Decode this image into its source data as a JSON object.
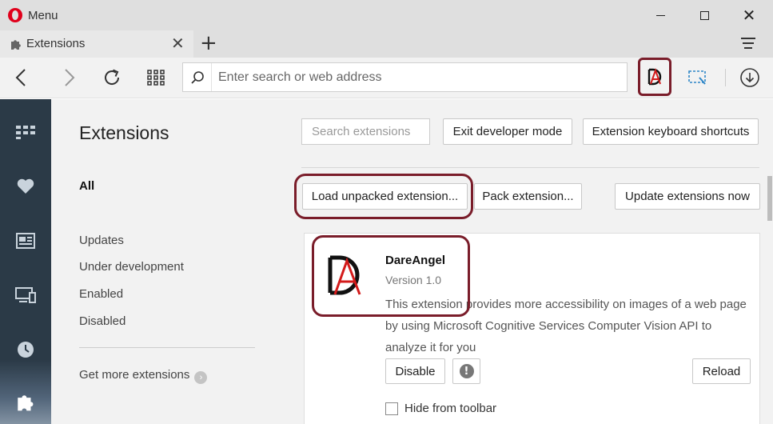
{
  "window": {
    "menu_label": "Menu",
    "minimize_icon": "minimize-icon",
    "maximize_icon": "maximize-icon",
    "close_glyph": "✕"
  },
  "tab": {
    "title": "Extensions",
    "close_glyph": "✕",
    "new_tab_glyph": "+"
  },
  "toolbar": {
    "address_placeholder": "Enter search or web address"
  },
  "extensions_nav": {
    "heading": "Extensions",
    "items": [
      {
        "label": "All"
      },
      {
        "label": "Updates"
      },
      {
        "label": "Under development"
      },
      {
        "label": "Enabled"
      },
      {
        "label": "Disabled"
      }
    ],
    "get_more": "Get more extensions",
    "get_more_arrow": "›"
  },
  "content": {
    "search_placeholder": "Search extensions",
    "buttons": {
      "exit_dev": "Exit developer mode",
      "shortcuts": "Extension keyboard shortcuts",
      "load_unpacked": "Load unpacked extension...",
      "pack": "Pack extension...",
      "update": "Update extensions now"
    },
    "extension": {
      "name": "DareAngel",
      "version": "Version 1.0",
      "description": "This extension provides more accessibility on images of a web page by using Microsoft Cognitive Services Computer Vision API to analyze it for you",
      "disable_label": "Disable",
      "info_glyph": "!",
      "reload_label": "Reload",
      "hide_label": "Hide from toolbar"
    }
  },
  "colors": {
    "highlight": "#7a1d2a",
    "opera_red": "#e0001b",
    "sidebar": "#2b3a47"
  }
}
